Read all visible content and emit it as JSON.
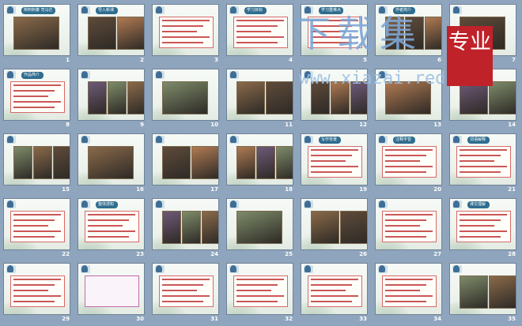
{
  "slides": [
    {
      "num": "1",
      "title": "荆轲刺秦 司马迁",
      "kind": "cover"
    },
    {
      "num": "2",
      "title": "导入新课",
      "kind": "photo"
    },
    {
      "num": "3",
      "title": "",
      "kind": "text"
    },
    {
      "num": "4",
      "title": "学习目标",
      "kind": "text"
    },
    {
      "num": "5",
      "title": "学习重难点",
      "kind": "text"
    },
    {
      "num": "6",
      "title": "作者简介",
      "kind": "photo"
    },
    {
      "num": "7",
      "title": "",
      "kind": "photo"
    },
    {
      "num": "8",
      "title": "作品简介",
      "kind": "text"
    },
    {
      "num": "9",
      "title": "",
      "kind": "photo"
    },
    {
      "num": "10",
      "title": "",
      "kind": "photo"
    },
    {
      "num": "11",
      "title": "",
      "kind": "photo"
    },
    {
      "num": "12",
      "title": "",
      "kind": "photo"
    },
    {
      "num": "13",
      "title": "",
      "kind": "photo"
    },
    {
      "num": "14",
      "title": "",
      "kind": "photo"
    },
    {
      "num": "15",
      "title": "",
      "kind": "photo"
    },
    {
      "num": "16",
      "title": "",
      "kind": "photo"
    },
    {
      "num": "17",
      "title": "",
      "kind": "photo"
    },
    {
      "num": "18",
      "title": "",
      "kind": "photo"
    },
    {
      "num": "19",
      "title": "写作背景",
      "kind": "text"
    },
    {
      "num": "20",
      "title": "注释字音",
      "kind": "text"
    },
    {
      "num": "21",
      "title": "词语解释",
      "kind": "text"
    },
    {
      "num": "22",
      "title": "",
      "kind": "text"
    },
    {
      "num": "23",
      "title": "整体感知",
      "kind": "text"
    },
    {
      "num": "24",
      "title": "",
      "kind": "photo"
    },
    {
      "num": "25",
      "title": "",
      "kind": "photo"
    },
    {
      "num": "26",
      "title": "",
      "kind": "photo"
    },
    {
      "num": "27",
      "title": "",
      "kind": "text"
    },
    {
      "num": "28",
      "title": "课文理解",
      "kind": "text"
    },
    {
      "num": "29",
      "title": "",
      "kind": "text"
    },
    {
      "num": "30",
      "title": "",
      "kind": "diagram"
    },
    {
      "num": "31",
      "title": "",
      "kind": "text"
    },
    {
      "num": "32",
      "title": "",
      "kind": "text"
    },
    {
      "num": "33",
      "title": "",
      "kind": "text"
    },
    {
      "num": "34",
      "title": "",
      "kind": "text"
    },
    {
      "num": "35",
      "title": "",
      "kind": "photo"
    }
  ],
  "watermark": {
    "main": "下载集",
    "url": "www.xiazai.red",
    "badge": "专业"
  }
}
